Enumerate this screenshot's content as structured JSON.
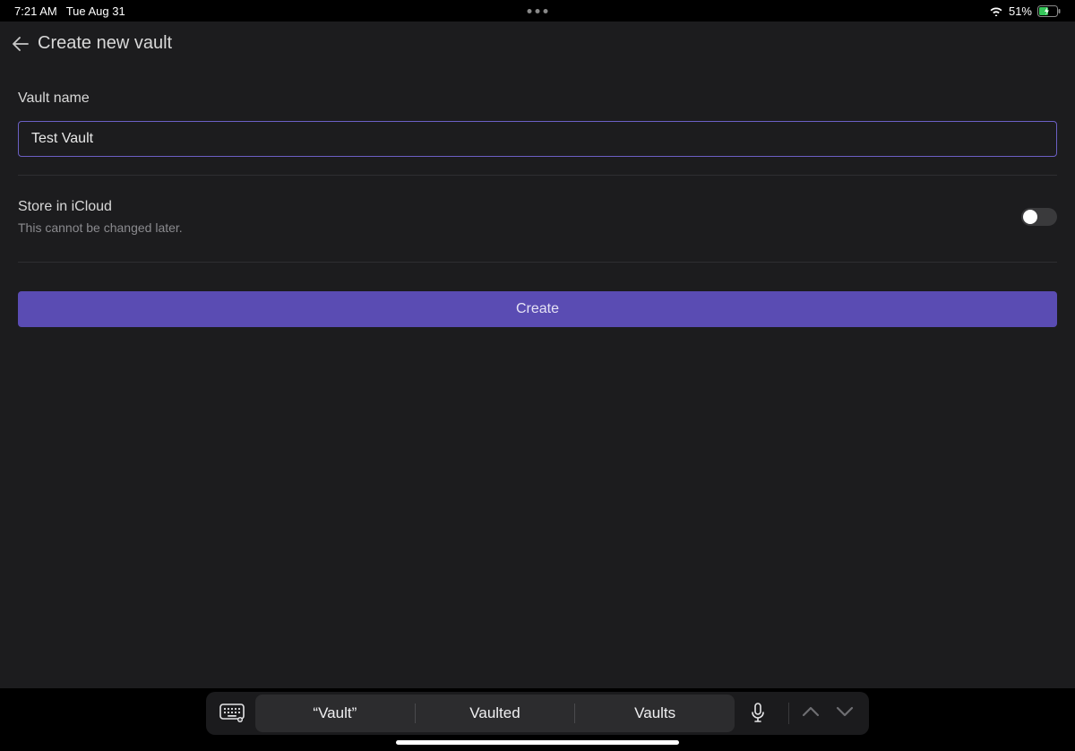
{
  "statusBar": {
    "time": "7:21 AM",
    "date": "Tue Aug 31",
    "batteryPercent": "51%"
  },
  "header": {
    "title": "Create new vault"
  },
  "form": {
    "vaultNameLabel": "Vault name",
    "vaultNameValue": "Test Vault",
    "icloud": {
      "title": "Store in iCloud",
      "subtitle": "This cannot be changed later.",
      "on": false
    },
    "createButtonLabel": "Create"
  },
  "suggestions": {
    "items": [
      "“Vault”",
      "Vaulted",
      "Vaults"
    ]
  },
  "colors": {
    "accent": "#5a4cb3",
    "inputBorder": "#6b5fc4",
    "bg": "#1c1c1e"
  }
}
